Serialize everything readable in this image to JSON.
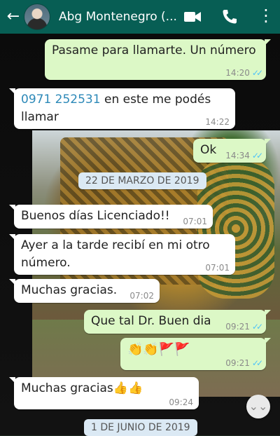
{
  "header": {
    "back_icon": "←",
    "contact_name": "Abg Montenegro (...",
    "video_icon": "video-call-icon",
    "call_icon": "phone-icon",
    "menu_icon": "⋮"
  },
  "dates": {
    "first": "22 DE MARZO DE 2019",
    "second": "1 DE JUNIO DE 2019"
  },
  "messages": [
    {
      "side": "out",
      "text": "Pasame para llamarte. Un número",
      "time": "14:20",
      "read": "✓✓"
    },
    {
      "side": "in",
      "link": "0971 252531",
      "text": " en este me podés llamar",
      "time": "14:22"
    },
    {
      "side": "out",
      "text": "Ok",
      "time": "14:34",
      "read": "✓✓"
    },
    {
      "side": "in",
      "text": "Buenos días Licenciado!!",
      "time": "07:01"
    },
    {
      "side": "in",
      "text": "Ayer a la tarde recibí en mi otro número.",
      "time": "07:01"
    },
    {
      "side": "in",
      "text": "Muchas gracias.",
      "time": "07:02"
    },
    {
      "side": "out",
      "text": "Que tal Dr. Buen dia",
      "time": "09:21",
      "read": "✓✓"
    },
    {
      "side": "out",
      "text": "👏👏🚩🚩",
      "time": "09:21",
      "read": "✓✓"
    },
    {
      "side": "in",
      "text": "Muchas gracias👍👍",
      "time": "09:24"
    }
  ],
  "scroll_button": "⌄⌄"
}
